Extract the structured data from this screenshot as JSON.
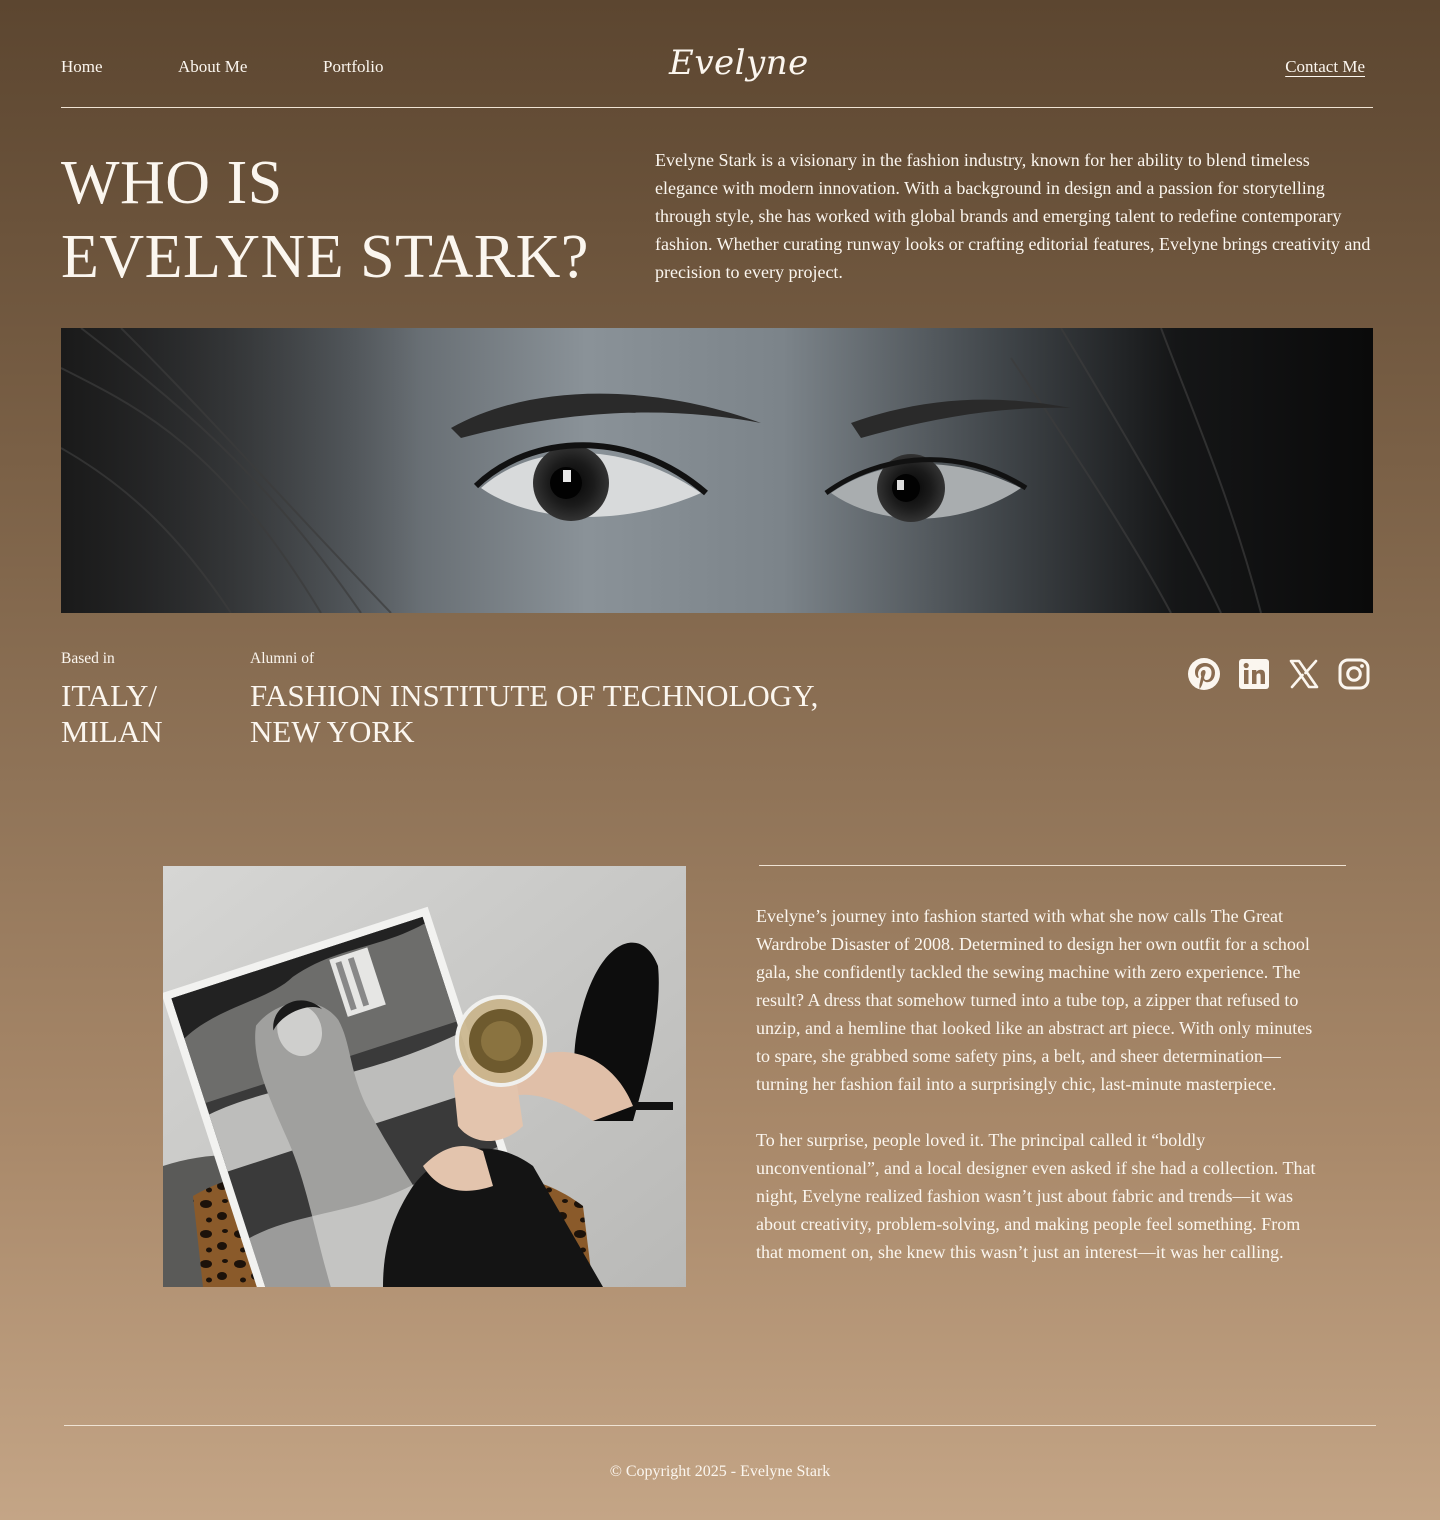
{
  "nav": {
    "home": "Home",
    "about": "About Me",
    "portfolio": "Portfolio",
    "logo": "Evelyne",
    "contact": "Contact Me"
  },
  "hero": {
    "title_line1": "WHO IS",
    "title_line2": "EVELYNE STARK?",
    "bio": "Evelyne Stark is a visionary in the fashion industry, known for her ability to blend timeless elegance with modern innovation. With a background in design and a passion for storytelling through style, she has worked with global brands and emerging talent to redefine contemporary fashion. Whether curating runway looks or crafting editorial features, Evelyne brings creativity and precision to every project."
  },
  "meta": {
    "based_label": "Based in",
    "based_line1": "ITALY/",
    "based_line2": "MILAN",
    "alumni_label": "Alumni of",
    "alumni_line1": "FASHION INSTITUTE OF TECHNOLOGY,",
    "alumni_line2": "NEW YORK"
  },
  "social": {
    "icons": [
      "pinterest-icon",
      "linkedin-icon",
      "x-icon",
      "instagram-icon"
    ]
  },
  "story": {
    "paragraph1": "Evelyne’s journey into fashion started with what she now calls The Great Wardrobe Disaster of 2008. Determined to design her own outfit for a school gala, she confidently tackled the sewing machine with zero experience. The result? A dress that somehow turned into a tube top, a zipper that refused to unzip, and a hemline that looked like an abstract art piece. With only minutes to spare, she grabbed some safety pins, a belt, and sheer determination—turning her fashion fail into a surprisingly chic, last-minute masterpiece.",
    "paragraph2": "To her surprise, people loved it. The principal called it “boldly unconventional”, and a local designer even asked if she had a collection. That night, Evelyne realized fashion wasn’t just about fabric and trends—it was about creativity, problem-solving, and making people feel something. From that moment on, she knew this wasn’t just an interest—it was her calling."
  },
  "footer": {
    "copyright": "© Copyright 2025 - Evelyne Stark"
  },
  "colors": {
    "text": "#fbf6ef",
    "bg_top": "#5c4630",
    "bg_bottom": "#c4a586"
  }
}
